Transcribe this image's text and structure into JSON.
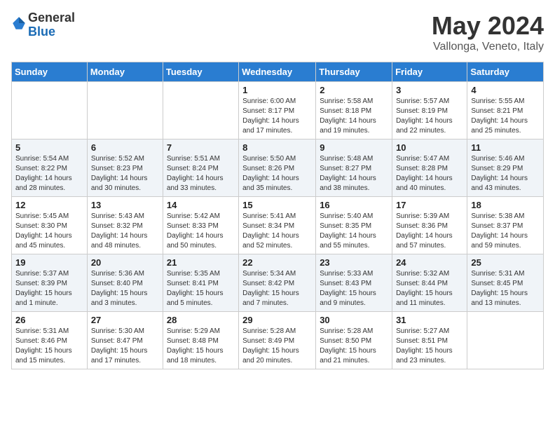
{
  "header": {
    "logo_general": "General",
    "logo_blue": "Blue",
    "month_title": "May 2024",
    "location": "Vallonga, Veneto, Italy"
  },
  "days_of_week": [
    "Sunday",
    "Monday",
    "Tuesday",
    "Wednesday",
    "Thursday",
    "Friday",
    "Saturday"
  ],
  "weeks": [
    [
      {
        "day": "",
        "info": ""
      },
      {
        "day": "",
        "info": ""
      },
      {
        "day": "",
        "info": ""
      },
      {
        "day": "1",
        "info": "Sunrise: 6:00 AM\nSunset: 8:17 PM\nDaylight: 14 hours\nand 17 minutes."
      },
      {
        "day": "2",
        "info": "Sunrise: 5:58 AM\nSunset: 8:18 PM\nDaylight: 14 hours\nand 19 minutes."
      },
      {
        "day": "3",
        "info": "Sunrise: 5:57 AM\nSunset: 8:19 PM\nDaylight: 14 hours\nand 22 minutes."
      },
      {
        "day": "4",
        "info": "Sunrise: 5:55 AM\nSunset: 8:21 PM\nDaylight: 14 hours\nand 25 minutes."
      }
    ],
    [
      {
        "day": "5",
        "info": "Sunrise: 5:54 AM\nSunset: 8:22 PM\nDaylight: 14 hours\nand 28 minutes."
      },
      {
        "day": "6",
        "info": "Sunrise: 5:52 AM\nSunset: 8:23 PM\nDaylight: 14 hours\nand 30 minutes."
      },
      {
        "day": "7",
        "info": "Sunrise: 5:51 AM\nSunset: 8:24 PM\nDaylight: 14 hours\nand 33 minutes."
      },
      {
        "day": "8",
        "info": "Sunrise: 5:50 AM\nSunset: 8:26 PM\nDaylight: 14 hours\nand 35 minutes."
      },
      {
        "day": "9",
        "info": "Sunrise: 5:48 AM\nSunset: 8:27 PM\nDaylight: 14 hours\nand 38 minutes."
      },
      {
        "day": "10",
        "info": "Sunrise: 5:47 AM\nSunset: 8:28 PM\nDaylight: 14 hours\nand 40 minutes."
      },
      {
        "day": "11",
        "info": "Sunrise: 5:46 AM\nSunset: 8:29 PM\nDaylight: 14 hours\nand 43 minutes."
      }
    ],
    [
      {
        "day": "12",
        "info": "Sunrise: 5:45 AM\nSunset: 8:30 PM\nDaylight: 14 hours\nand 45 minutes."
      },
      {
        "day": "13",
        "info": "Sunrise: 5:43 AM\nSunset: 8:32 PM\nDaylight: 14 hours\nand 48 minutes."
      },
      {
        "day": "14",
        "info": "Sunrise: 5:42 AM\nSunset: 8:33 PM\nDaylight: 14 hours\nand 50 minutes."
      },
      {
        "day": "15",
        "info": "Sunrise: 5:41 AM\nSunset: 8:34 PM\nDaylight: 14 hours\nand 52 minutes."
      },
      {
        "day": "16",
        "info": "Sunrise: 5:40 AM\nSunset: 8:35 PM\nDaylight: 14 hours\nand 55 minutes."
      },
      {
        "day": "17",
        "info": "Sunrise: 5:39 AM\nSunset: 8:36 PM\nDaylight: 14 hours\nand 57 minutes."
      },
      {
        "day": "18",
        "info": "Sunrise: 5:38 AM\nSunset: 8:37 PM\nDaylight: 14 hours\nand 59 minutes."
      }
    ],
    [
      {
        "day": "19",
        "info": "Sunrise: 5:37 AM\nSunset: 8:39 PM\nDaylight: 15 hours\nand 1 minute."
      },
      {
        "day": "20",
        "info": "Sunrise: 5:36 AM\nSunset: 8:40 PM\nDaylight: 15 hours\nand 3 minutes."
      },
      {
        "day": "21",
        "info": "Sunrise: 5:35 AM\nSunset: 8:41 PM\nDaylight: 15 hours\nand 5 minutes."
      },
      {
        "day": "22",
        "info": "Sunrise: 5:34 AM\nSunset: 8:42 PM\nDaylight: 15 hours\nand 7 minutes."
      },
      {
        "day": "23",
        "info": "Sunrise: 5:33 AM\nSunset: 8:43 PM\nDaylight: 15 hours\nand 9 minutes."
      },
      {
        "day": "24",
        "info": "Sunrise: 5:32 AM\nSunset: 8:44 PM\nDaylight: 15 hours\nand 11 minutes."
      },
      {
        "day": "25",
        "info": "Sunrise: 5:31 AM\nSunset: 8:45 PM\nDaylight: 15 hours\nand 13 minutes."
      }
    ],
    [
      {
        "day": "26",
        "info": "Sunrise: 5:31 AM\nSunset: 8:46 PM\nDaylight: 15 hours\nand 15 minutes."
      },
      {
        "day": "27",
        "info": "Sunrise: 5:30 AM\nSunset: 8:47 PM\nDaylight: 15 hours\nand 17 minutes."
      },
      {
        "day": "28",
        "info": "Sunrise: 5:29 AM\nSunset: 8:48 PM\nDaylight: 15 hours\nand 18 minutes."
      },
      {
        "day": "29",
        "info": "Sunrise: 5:28 AM\nSunset: 8:49 PM\nDaylight: 15 hours\nand 20 minutes."
      },
      {
        "day": "30",
        "info": "Sunrise: 5:28 AM\nSunset: 8:50 PM\nDaylight: 15 hours\nand 21 minutes."
      },
      {
        "day": "31",
        "info": "Sunrise: 5:27 AM\nSunset: 8:51 PM\nDaylight: 15 hours\nand 23 minutes."
      },
      {
        "day": "",
        "info": ""
      }
    ]
  ]
}
